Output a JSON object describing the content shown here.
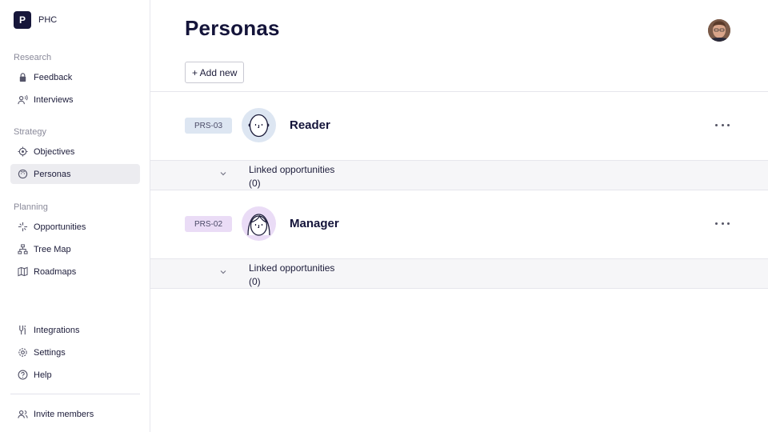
{
  "workspace": {
    "logo_letter": "P",
    "name": "PHC"
  },
  "sidebar": {
    "sections": [
      {
        "title": "Research",
        "items": [
          {
            "label": "Feedback",
            "icon": "lock-icon"
          },
          {
            "label": "Interviews",
            "icon": "voice-icon"
          }
        ]
      },
      {
        "title": "Strategy",
        "items": [
          {
            "label": "Objectives",
            "icon": "target-icon"
          },
          {
            "label": "Personas",
            "icon": "face-icon",
            "active": true
          }
        ]
      },
      {
        "title": "Planning",
        "items": [
          {
            "label": "Opportunities",
            "icon": "sparkle-icon"
          },
          {
            "label": "Tree Map",
            "icon": "tree-icon"
          },
          {
            "label": "Roadmaps",
            "icon": "map-icon"
          }
        ]
      }
    ],
    "bottom_items": [
      {
        "label": "Integrations",
        "icon": "plug-icon"
      },
      {
        "label": "Settings",
        "icon": "gear-icon"
      },
      {
        "label": "Help",
        "icon": "help-icon"
      }
    ],
    "invite_label": "Invite members"
  },
  "main": {
    "title": "Personas",
    "add_label": "+ Add new",
    "personas": [
      {
        "tag": "PRS-03",
        "name": "Reader",
        "color": "#dde6f2",
        "linked_label": "Linked opportunities (0)"
      },
      {
        "tag": "PRS-02",
        "name": "Manager",
        "color": "#eadcf6",
        "linked_label": "Linked opportunities (0)"
      }
    ]
  },
  "colors": {
    "accent_dark": "#16163a",
    "active_bg": "#ececf0",
    "tag_blue": "#dde6f2",
    "tag_purple": "#eadcf6"
  }
}
